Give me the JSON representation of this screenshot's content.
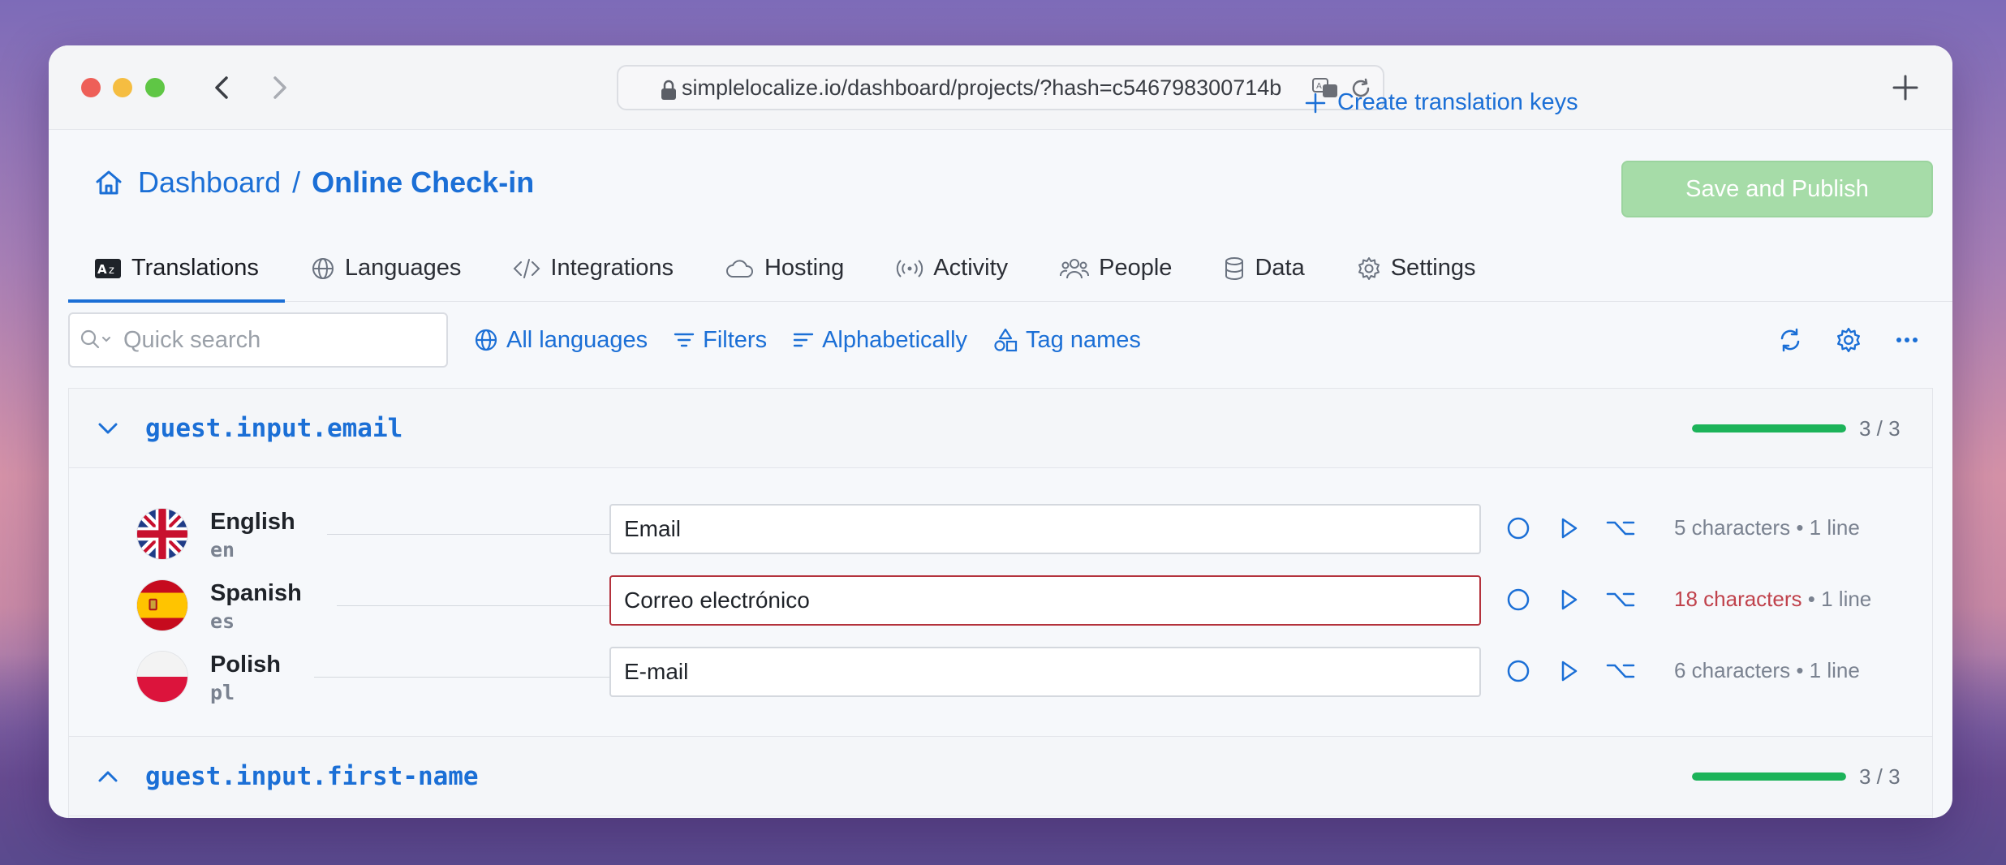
{
  "browser": {
    "url": "simplelocalize.io/dashboard/projects/?hash=c546798300714b"
  },
  "header": {
    "crumb_root": "Dashboard",
    "crumb_separator": "/",
    "crumb_project": "Online Check-in",
    "create_keys_label": "Create translation keys",
    "publish_label": "Save and Publish"
  },
  "tabs": [
    {
      "label": "Translations",
      "icon": "translate-icon",
      "active": true
    },
    {
      "label": "Languages",
      "icon": "globe-icon"
    },
    {
      "label": "Integrations",
      "icon": "code-icon"
    },
    {
      "label": "Hosting",
      "icon": "cloud-icon"
    },
    {
      "label": "Activity",
      "icon": "broadcast-icon"
    },
    {
      "label": "People",
      "icon": "people-icon"
    },
    {
      "label": "Data",
      "icon": "database-icon"
    },
    {
      "label": "Settings",
      "icon": "gear-icon"
    }
  ],
  "toolbar": {
    "search_placeholder": "Quick search",
    "all_languages": "All languages",
    "filters": "Filters",
    "sort": "Alphabetically",
    "tags": "Tag names"
  },
  "colors": {
    "accent": "#1b6fd6",
    "progress": "#1cb35a",
    "publish_disabled": "#a6dca8",
    "error": "#c0424c"
  },
  "keys": [
    {
      "name": "guest.input.email",
      "expanded": true,
      "progress_label": "3 / 3",
      "progress_fraction": 1.0,
      "translations": [
        {
          "language": "English",
          "code": "en",
          "value": "Email",
          "characters": "5 characters",
          "lines": "1 line",
          "over_limit": false
        },
        {
          "language": "Spanish",
          "code": "es",
          "value": "Correo electrónico",
          "characters": "18 characters",
          "lines": "1 line",
          "over_limit": true
        },
        {
          "language": "Polish",
          "code": "pl",
          "value": "E-mail",
          "characters": "6 characters",
          "lines": "1 line",
          "over_limit": false
        }
      ]
    },
    {
      "name": "guest.input.first-name",
      "expanded": false,
      "progress_label": "3 / 3",
      "progress_fraction": 1.0
    }
  ],
  "meta_dot": "•"
}
